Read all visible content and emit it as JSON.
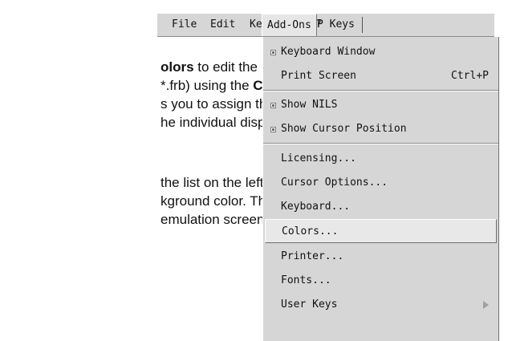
{
  "menubar": {
    "file": "File",
    "edit": "Edit",
    "keyboard": "Keyboard",
    "pkeys": "P Keys",
    "addons": "Add-Ons",
    "help": "?"
  },
  "doc": {
    "l1a": "olors",
    "l1b": " to edit the",
    "l2a": "*.frb) using the ",
    "l2b": "Color",
    "l3": "s you to assign the",
    "l4": "he individual display",
    "l5": "the list on the left-hand",
    "l6": "kground color. The",
    "l7": "emulation screen."
  },
  "dropdown": {
    "items": [
      {
        "label": "Keyboard Window",
        "checked": true
      },
      {
        "label": "Print Screen",
        "accel": "Ctrl+P"
      },
      {
        "label": "Show NILS",
        "checked": true
      },
      {
        "label": "Show Cursor Position",
        "checked": true
      },
      {
        "label": "Licensing..."
      },
      {
        "label": "Cursor Options..."
      },
      {
        "label": "Keyboard..."
      },
      {
        "label": "Colors...",
        "selected": true
      },
      {
        "label": "Printer..."
      },
      {
        "label": "Fonts..."
      },
      {
        "label": "User Keys",
        "submenu": true
      }
    ]
  }
}
